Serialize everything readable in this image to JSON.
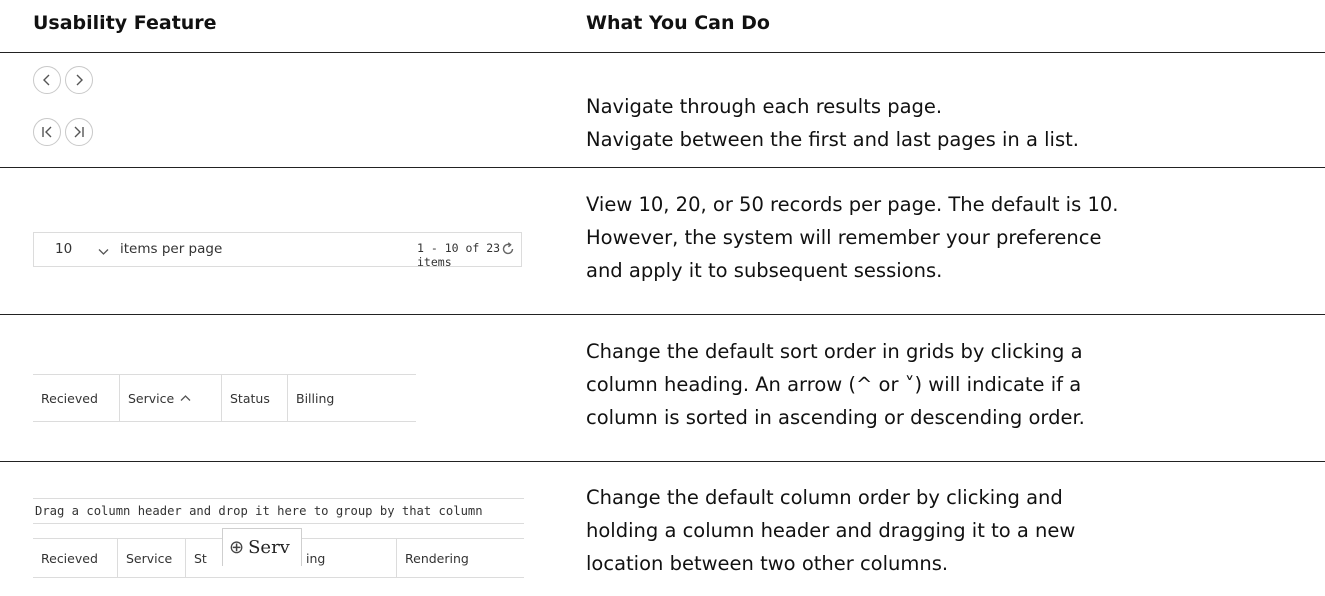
{
  "header": {
    "col1": "Usability Feature",
    "col2": "What You Can Do"
  },
  "rows": [
    {
      "lines": [
        "Navigate through each results page.",
        "Navigate between the first and last pages in a list."
      ],
      "icons": [
        "previous-page-icon",
        "next-page-icon",
        "first-page-icon",
        "last-page-icon"
      ]
    },
    {
      "lines": [
        "View 10, 20, or 50 records per page. The default is 10.",
        "However, the system will remember your preference",
        "and apply it to subsequent sessions."
      ],
      "pager": {
        "page_size": "10",
        "items_per_page_label": "items per page",
        "count_text": "1 - 10 of 23 items",
        "icons": [
          "chevron-down-icon",
          "refresh-icon"
        ]
      }
    },
    {
      "lines": [
        "Change the default sort order in grids by clicking a",
        "column heading. An arrow (^ or ˅) will indicate if a",
        "column is sorted in ascending or descending order."
      ],
      "columns": [
        "Recieved",
        "Service",
        "Status",
        "Billing"
      ],
      "sort_icon": "chevron-up-icon"
    },
    {
      "lines": [
        "Change the default column order by clicking and",
        "holding a column header and dragging it to a new",
        "location between two other columns."
      ],
      "group_hint": "Drag a column header and drop it here to group by that column",
      "columns": [
        "Recieved",
        "Service",
        "St",
        "ing",
        "Rendering"
      ],
      "drag_label": "Serv",
      "icons": [
        "plus-circle-icon",
        "drop-marker-icon"
      ]
    }
  ]
}
